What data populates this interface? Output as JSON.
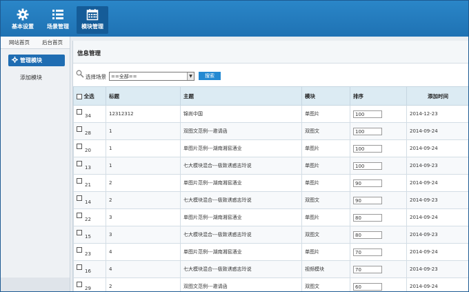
{
  "nav": {
    "items": [
      {
        "label": "基本设置",
        "icon": "gear-icon"
      },
      {
        "label": "场景管理",
        "icon": "list-icon"
      },
      {
        "label": "模块管理",
        "icon": "calendar-icon"
      }
    ]
  },
  "sidebar": {
    "tabs": [
      "网站首页",
      "后台首页"
    ],
    "active": "管理模块",
    "sub": "添加模块"
  },
  "main": {
    "title": "信息管理",
    "filter_label": "选择场景",
    "select_value": "==全部==",
    "search_label": "搜索"
  },
  "table": {
    "headers": {
      "select": "全选",
      "title": "标题",
      "theme": "主题",
      "module": "模块",
      "order": "排序",
      "time": "添加时间"
    },
    "rows": [
      {
        "id": "34",
        "title": "12312312",
        "theme": "锦尚中国",
        "module": "单图片",
        "order": "100",
        "time": "2014-12-23"
      },
      {
        "id": "28",
        "title": "1",
        "theme": "双图文范例---邀请函",
        "module": "双图文",
        "order": "100",
        "time": "2014-09-24"
      },
      {
        "id": "20",
        "title": "1",
        "theme": "单图片范例---湖南湘窖酒业",
        "module": "单图片",
        "order": "100",
        "time": "2014-09-24"
      },
      {
        "id": "13",
        "title": "1",
        "theme": "七大模块混合---极致诱惑志玲说",
        "module": "单图片",
        "order": "100",
        "time": "2014-09-23"
      },
      {
        "id": "21",
        "title": "2",
        "theme": "单图片范例---湖南湘窖酒业",
        "module": "单图片",
        "order": "90",
        "time": "2014-09-24"
      },
      {
        "id": "14",
        "title": "2",
        "theme": "七大模块混合---极致诱惑志玲说",
        "module": "双图文",
        "order": "90",
        "time": "2014-09-23"
      },
      {
        "id": "22",
        "title": "3",
        "theme": "单图片范例---湖南湘窖酒业",
        "module": "单图片",
        "order": "80",
        "time": "2014-09-24"
      },
      {
        "id": "15",
        "title": "3",
        "theme": "七大模块混合---极致诱惑志玲说",
        "module": "双图文",
        "order": "80",
        "time": "2014-09-23"
      },
      {
        "id": "23",
        "title": "4",
        "theme": "单图片范例---湖南湘窖酒业",
        "module": "单图片",
        "order": "70",
        "time": "2014-09-24"
      },
      {
        "id": "16",
        "title": "4",
        "theme": "七大模块混合---极致诱惑志玲说",
        "module": "视频模块",
        "order": "70",
        "time": "2014-09-23"
      },
      {
        "id": "29",
        "title": "2",
        "theme": "双图文范例---邀请函",
        "module": "双图文",
        "order": "60",
        "time": "2014-09-24"
      }
    ]
  }
}
